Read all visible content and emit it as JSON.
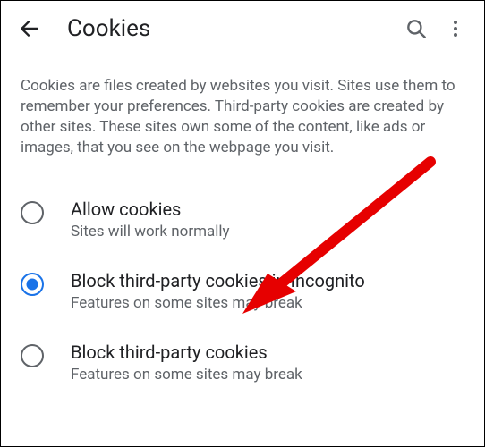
{
  "header": {
    "title": "Cookies"
  },
  "description": "Cookies are files created by websites you visit. Sites use them to remember your preferences. Third-party cookies are created by other sites. These sites own some of the content, like ads or images, that you see on the webpage you visit.",
  "options": [
    {
      "title": "Allow cookies",
      "subtitle": "Sites will work normally",
      "selected": false
    },
    {
      "title": "Block third-party cookies in Incognito",
      "subtitle": "Features on some sites may break",
      "selected": true
    },
    {
      "title": "Block third-party cookies",
      "subtitle": "Features on some sites may break",
      "selected": false
    }
  ],
  "annotation": {
    "arrow_color": "#e60000",
    "arrow_target_option_index": 1
  }
}
